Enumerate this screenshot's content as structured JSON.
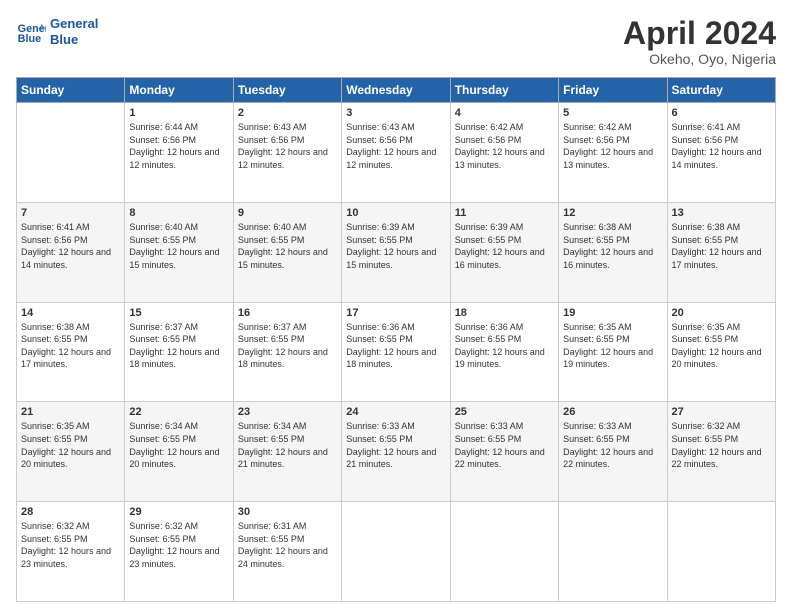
{
  "header": {
    "logo_line1": "General",
    "logo_line2": "Blue",
    "month": "April 2024",
    "location": "Okeho, Oyo, Nigeria"
  },
  "weekdays": [
    "Sunday",
    "Monday",
    "Tuesday",
    "Wednesday",
    "Thursday",
    "Friday",
    "Saturday"
  ],
  "weeks": [
    [
      {
        "day": "",
        "sunrise": "",
        "sunset": "",
        "daylight": ""
      },
      {
        "day": "1",
        "sunrise": "6:44 AM",
        "sunset": "6:56 PM",
        "daylight": "12 hours and 12 minutes."
      },
      {
        "day": "2",
        "sunrise": "6:43 AM",
        "sunset": "6:56 PM",
        "daylight": "12 hours and 12 minutes."
      },
      {
        "day": "3",
        "sunrise": "6:43 AM",
        "sunset": "6:56 PM",
        "daylight": "12 hours and 12 minutes."
      },
      {
        "day": "4",
        "sunrise": "6:42 AM",
        "sunset": "6:56 PM",
        "daylight": "12 hours and 13 minutes."
      },
      {
        "day": "5",
        "sunrise": "6:42 AM",
        "sunset": "6:56 PM",
        "daylight": "12 hours and 13 minutes."
      },
      {
        "day": "6",
        "sunrise": "6:41 AM",
        "sunset": "6:56 PM",
        "daylight": "12 hours and 14 minutes."
      }
    ],
    [
      {
        "day": "7",
        "sunrise": "6:41 AM",
        "sunset": "6:56 PM",
        "daylight": "12 hours and 14 minutes."
      },
      {
        "day": "8",
        "sunrise": "6:40 AM",
        "sunset": "6:55 PM",
        "daylight": "12 hours and 15 minutes."
      },
      {
        "day": "9",
        "sunrise": "6:40 AM",
        "sunset": "6:55 PM",
        "daylight": "12 hours and 15 minutes."
      },
      {
        "day": "10",
        "sunrise": "6:39 AM",
        "sunset": "6:55 PM",
        "daylight": "12 hours and 15 minutes."
      },
      {
        "day": "11",
        "sunrise": "6:39 AM",
        "sunset": "6:55 PM",
        "daylight": "12 hours and 16 minutes."
      },
      {
        "day": "12",
        "sunrise": "6:38 AM",
        "sunset": "6:55 PM",
        "daylight": "12 hours and 16 minutes."
      },
      {
        "day": "13",
        "sunrise": "6:38 AM",
        "sunset": "6:55 PM",
        "daylight": "12 hours and 17 minutes."
      }
    ],
    [
      {
        "day": "14",
        "sunrise": "6:38 AM",
        "sunset": "6:55 PM",
        "daylight": "12 hours and 17 minutes."
      },
      {
        "day": "15",
        "sunrise": "6:37 AM",
        "sunset": "6:55 PM",
        "daylight": "12 hours and 18 minutes."
      },
      {
        "day": "16",
        "sunrise": "6:37 AM",
        "sunset": "6:55 PM",
        "daylight": "12 hours and 18 minutes."
      },
      {
        "day": "17",
        "sunrise": "6:36 AM",
        "sunset": "6:55 PM",
        "daylight": "12 hours and 18 minutes."
      },
      {
        "day": "18",
        "sunrise": "6:36 AM",
        "sunset": "6:55 PM",
        "daylight": "12 hours and 19 minutes."
      },
      {
        "day": "19",
        "sunrise": "6:35 AM",
        "sunset": "6:55 PM",
        "daylight": "12 hours and 19 minutes."
      },
      {
        "day": "20",
        "sunrise": "6:35 AM",
        "sunset": "6:55 PM",
        "daylight": "12 hours and 20 minutes."
      }
    ],
    [
      {
        "day": "21",
        "sunrise": "6:35 AM",
        "sunset": "6:55 PM",
        "daylight": "12 hours and 20 minutes."
      },
      {
        "day": "22",
        "sunrise": "6:34 AM",
        "sunset": "6:55 PM",
        "daylight": "12 hours and 20 minutes."
      },
      {
        "day": "23",
        "sunrise": "6:34 AM",
        "sunset": "6:55 PM",
        "daylight": "12 hours and 21 minutes."
      },
      {
        "day": "24",
        "sunrise": "6:33 AM",
        "sunset": "6:55 PM",
        "daylight": "12 hours and 21 minutes."
      },
      {
        "day": "25",
        "sunrise": "6:33 AM",
        "sunset": "6:55 PM",
        "daylight": "12 hours and 22 minutes."
      },
      {
        "day": "26",
        "sunrise": "6:33 AM",
        "sunset": "6:55 PM",
        "daylight": "12 hours and 22 minutes."
      },
      {
        "day": "27",
        "sunrise": "6:32 AM",
        "sunset": "6:55 PM",
        "daylight": "12 hours and 22 minutes."
      }
    ],
    [
      {
        "day": "28",
        "sunrise": "6:32 AM",
        "sunset": "6:55 PM",
        "daylight": "12 hours and 23 minutes."
      },
      {
        "day": "29",
        "sunrise": "6:32 AM",
        "sunset": "6:55 PM",
        "daylight": "12 hours and 23 minutes."
      },
      {
        "day": "30",
        "sunrise": "6:31 AM",
        "sunset": "6:55 PM",
        "daylight": "12 hours and 24 minutes."
      },
      {
        "day": "",
        "sunrise": "",
        "sunset": "",
        "daylight": ""
      },
      {
        "day": "",
        "sunrise": "",
        "sunset": "",
        "daylight": ""
      },
      {
        "day": "",
        "sunrise": "",
        "sunset": "",
        "daylight": ""
      },
      {
        "day": "",
        "sunrise": "",
        "sunset": "",
        "daylight": ""
      }
    ]
  ]
}
